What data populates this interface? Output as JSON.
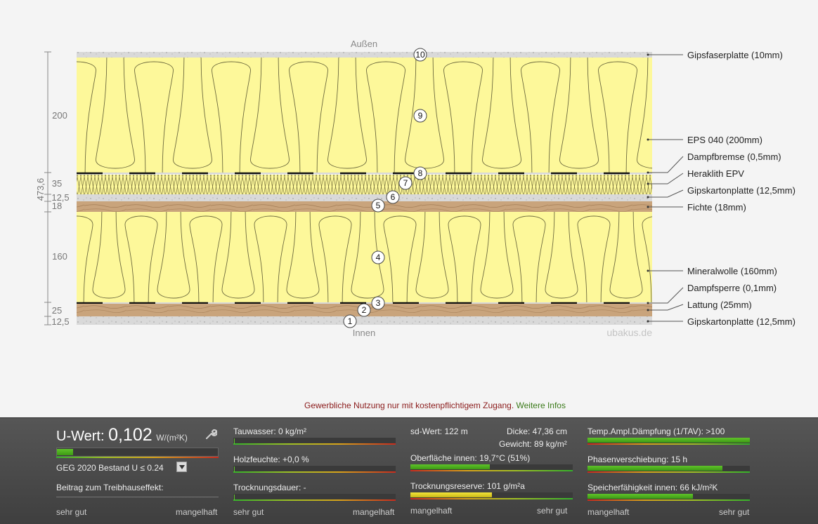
{
  "diagram": {
    "outside_label": "Außen",
    "inside_label": "Innen",
    "watermark": "ubakus.de",
    "total_thickness": "473,6",
    "dimensions": [
      "200",
      "35",
      "12,5",
      "18",
      "160",
      "25",
      "12,5"
    ],
    "layers": [
      {
        "number": "10",
        "label": "Gipsfaserplatte (10mm)"
      },
      {
        "number": "9",
        "label": "EPS 040 (200mm)"
      },
      {
        "number": "8",
        "label": "Dampfbremse (0,5mm)"
      },
      {
        "number": "7",
        "label": "Heraklith EPV"
      },
      {
        "number": "6",
        "label": "Gipskartonplatte (12,5mm)"
      },
      {
        "number": "5",
        "label": "Fichte (18mm)"
      },
      {
        "number": "4",
        "label": "Mineralwolle (160mm)"
      },
      {
        "number": "3",
        "label": "Dampfsperre (0,1mm)"
      },
      {
        "number": "2",
        "label": "Lattung (25mm)"
      },
      {
        "number": "1",
        "label": "Gipskartonplatte (12,5mm)"
      }
    ],
    "colors": {
      "insulation": "#fdf89a",
      "wood": "#c9a37a",
      "gypsum": "#d8d8d8"
    }
  },
  "notice": {
    "text": "Gewerbliche Nutzung nur mit kostenpflichtigem Zugang.",
    "link": "Weitere Infos"
  },
  "results": {
    "uwert": {
      "label": "U-Wert:",
      "value": "0,102",
      "unit": "W/(m²K)",
      "fraction": 0.1
    },
    "geg": "GEG 2020 Bestand U ≤ 0.24",
    "treibhaus": "Beitrag zum Treibhauseffekt:",
    "col1_scale": {
      "left": "sehr gut",
      "right": "mangelhaft"
    },
    "tauwasser": {
      "text": "Tauwasser: 0 kg/m²",
      "fraction": 0.0
    },
    "holzfeuchte": {
      "text": "Holzfeuchte: +0,0 %",
      "fraction": 0.0
    },
    "trocknungsdauer": {
      "text": "Trocknungsdauer: -",
      "fraction": 0.0
    },
    "col2_scale": {
      "left": "sehr gut",
      "right": "mangelhaft"
    },
    "sdwert": "sd-Wert: 122 m",
    "dicke": "Dicke: 47,36 cm",
    "gewicht": "Gewicht: 89 kg/m²",
    "oberflaeche": {
      "text": "Oberfläche innen: 19,7°C (51%)",
      "fraction": 0.49
    },
    "trocknungsreserve": {
      "text": "Trocknungsreserve: 101 g/m²a",
      "fraction": 0.5
    },
    "col3_scale": {
      "left": "mangelhaft",
      "right": "sehr gut"
    },
    "temp_ampl": {
      "text": "Temp.Ampl.Dämpfung (1/TAV): >100",
      "fraction": 1.0
    },
    "phasen": {
      "text": "Phasenverschiebung: 15 h",
      "fraction": 0.83
    },
    "speicher": {
      "text": "Speicherfähigkeit innen: 66 kJ/m²K",
      "fraction": 0.65
    },
    "col4_scale": {
      "left": "mangelhaft",
      "right": "sehr gut"
    }
  }
}
